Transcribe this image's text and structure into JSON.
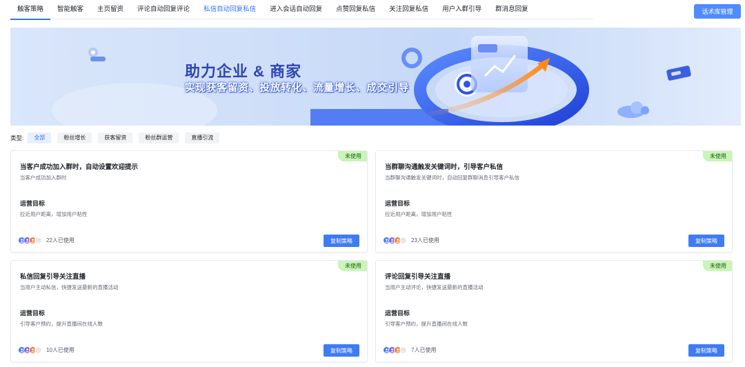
{
  "tabs": [
    {
      "label": "触客策略",
      "state": "active"
    },
    {
      "label": "智能触客",
      "state": ""
    },
    {
      "label": "主页留资",
      "state": ""
    },
    {
      "label": "评论自动回复评论",
      "state": ""
    },
    {
      "label": "私信自动回复私信",
      "state": "highlight"
    },
    {
      "label": "进入会话自动回复",
      "state": ""
    },
    {
      "label": "点赞回复私信",
      "state": ""
    },
    {
      "label": "关注回复私信",
      "state": ""
    },
    {
      "label": "用户入群引导",
      "state": ""
    },
    {
      "label": "群消息回复",
      "state": ""
    }
  ],
  "header": {
    "library_button": "话术库管理"
  },
  "banner": {
    "title": "助力企业 & 商家",
    "subtitle": "实现获客留资、投放转化、流量增长、成交引导"
  },
  "filter": {
    "label": "类型:",
    "chips": [
      "全部",
      "粉丝增长",
      "获客留资",
      "粉丝群运营",
      "直播引流"
    ],
    "active_index": 0
  },
  "cards": [
    {
      "badge": "未使用",
      "title": "当客户成功加入群时，自动设置欢迎提示",
      "desc": "当客户成功加入群时",
      "goal_title": "运营目标",
      "goal_desc": "拉近用户距离，增加用户粘性",
      "users_count": "22人已使用",
      "button": "复制策略"
    },
    {
      "badge": "未使用",
      "title": "当群聊沟通触发关键词时，引导客户私信",
      "desc": "当群聊沟通触发关键词时，自动回复群聊消息引导客户私信",
      "goal_title": "运营目标",
      "goal_desc": "拉近用户距离，增加用户粘性",
      "users_count": "23人已使用",
      "button": "复制策略"
    },
    {
      "badge": "未使用",
      "title": "私信回复引导关注直播",
      "desc": "当用户主动私信，快捷发送最新的直播活动",
      "goal_title": "运营目标",
      "goal_desc": "引导客户预约，提升直播间在线人数",
      "users_count": "10人已使用",
      "button": "复制策略"
    },
    {
      "badge": "未使用",
      "title": "评论回复引导关注直播",
      "desc": "当用户主动评论，快捷发送最新的直播活动",
      "goal_title": "运营目标",
      "goal_desc": "引导客户预约，提升直播间在线人数",
      "users_count": "7人已使用",
      "button": "复制策略"
    }
  ],
  "colors": {
    "accent": "#3370ff",
    "button": "#3f7bf5",
    "badge_bg": "#c9f5b9",
    "banner_title": "#2d46b4"
  }
}
